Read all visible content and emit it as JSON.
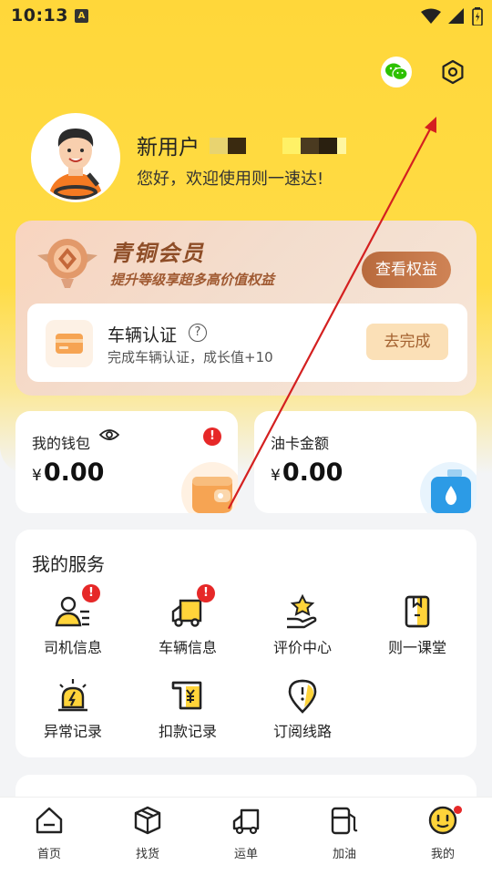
{
  "status_bar": {
    "time": "10:13",
    "notification_glyph": "A"
  },
  "header": {
    "icons": [
      "wechat-icon",
      "settings-icon"
    ]
  },
  "profile": {
    "username": "新用户",
    "greeting": "您好，欢迎使用则一速达!"
  },
  "member": {
    "level_title": "青铜会员",
    "subtitle": "提升等级享超多高价值权益",
    "benefits_button": "查看权益",
    "task": {
      "title": "车辆认证",
      "description": "完成车辆认证，成长值+10",
      "button": "去完成"
    }
  },
  "wallet": {
    "label": "我的钱包",
    "currency": "¥",
    "amount": "0.00",
    "badge": "!"
  },
  "fuel_card": {
    "label": "油卡金额",
    "currency": "¥",
    "amount": "0.00"
  },
  "services": {
    "title": "我的服务",
    "items": [
      {
        "label": "司机信息",
        "icon": "driver-info-icon",
        "badge": "!"
      },
      {
        "label": "车辆信息",
        "icon": "truck-info-icon",
        "badge": "!"
      },
      {
        "label": "评价中心",
        "icon": "rating-center-icon"
      },
      {
        "label": "则一课堂",
        "icon": "classroom-icon"
      },
      {
        "label": "异常记录",
        "icon": "exception-alarm-icon"
      },
      {
        "label": "扣款记录",
        "icon": "deduction-record-icon"
      },
      {
        "label": "订阅线路",
        "icon": "subscribe-route-icon"
      }
    ]
  },
  "tabbar": {
    "tabs": [
      {
        "label": "首页",
        "icon": "home-icon"
      },
      {
        "label": "找货",
        "icon": "cargo-box-icon"
      },
      {
        "label": "运单",
        "icon": "truck-icon"
      },
      {
        "label": "加油",
        "icon": "fuel-pump-icon"
      },
      {
        "label": "我的",
        "icon": "smiley-icon",
        "active": true
      }
    ]
  },
  "colors": {
    "brand_yellow": "#ffd73a",
    "member_brown": "#8e4d27",
    "alert_red": "#e62828",
    "annotation_arrow": "#d42020"
  }
}
